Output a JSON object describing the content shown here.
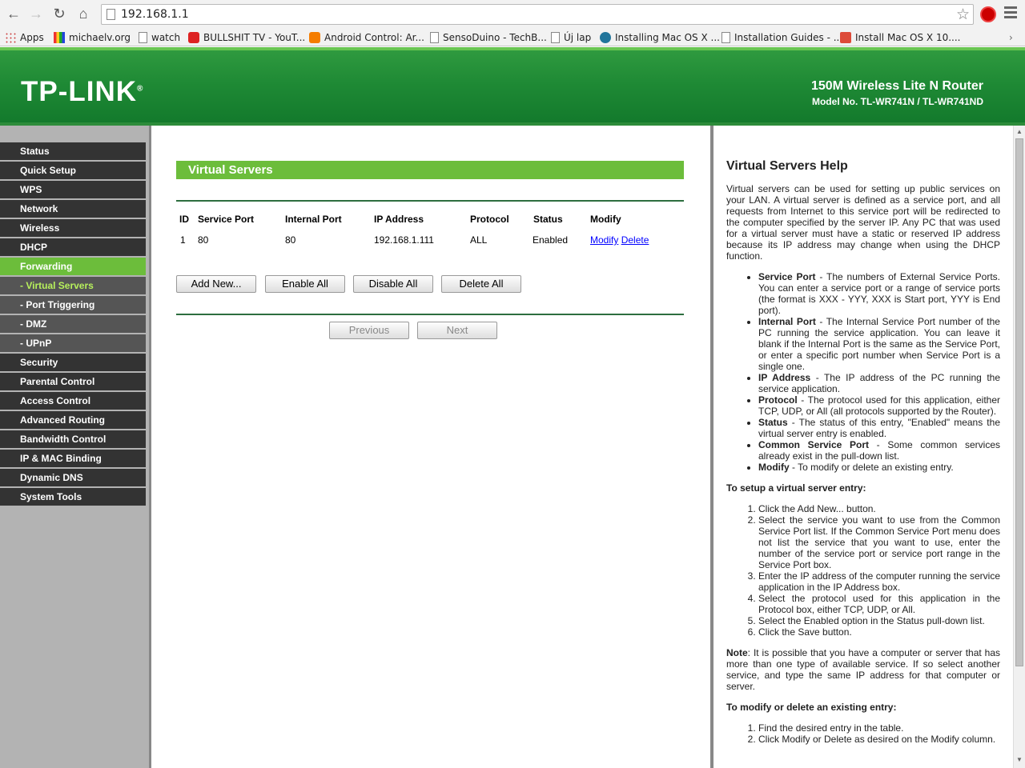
{
  "browser": {
    "url": "192.168.1.1",
    "bookmarks": [
      {
        "label": "Apps",
        "icon": "apps-grid-icon"
      },
      {
        "label": "michaelv.org",
        "icon": "site-icon"
      },
      {
        "label": "watch",
        "icon": "page-icon"
      },
      {
        "label": "BULLSHIT TV - YouT...",
        "icon": "youtube-icon"
      },
      {
        "label": "Android Control: Ar...",
        "icon": "blogger-icon"
      },
      {
        "label": "SensoDuino - TechB...",
        "icon": "page-icon"
      },
      {
        "label": "Új lap",
        "icon": "page-icon"
      },
      {
        "label": "Installing Mac OS X ...",
        "icon": "wordpress-icon"
      },
      {
        "label": "Installation Guides - ...",
        "icon": "page-icon"
      },
      {
        "label": "Install Mac OS X 10....",
        "icon": "google-plus-icon"
      }
    ]
  },
  "banner": {
    "logo": "TP-LINK",
    "logo_mark": "®",
    "product_name": "150M Wireless Lite N Router",
    "model": "Model No. TL-WR741N / TL-WR741ND"
  },
  "sidebar": {
    "items": [
      {
        "label": "Status"
      },
      {
        "label": "Quick Setup"
      },
      {
        "label": "WPS"
      },
      {
        "label": "Network"
      },
      {
        "label": "Wireless"
      },
      {
        "label": "DHCP"
      },
      {
        "label": "Forwarding"
      },
      {
        "label": "- Virtual Servers"
      },
      {
        "label": "- Port Triggering"
      },
      {
        "label": "- DMZ"
      },
      {
        "label": "- UPnP"
      },
      {
        "label": "Security"
      },
      {
        "label": "Parental Control"
      },
      {
        "label": "Access Control"
      },
      {
        "label": "Advanced Routing"
      },
      {
        "label": "Bandwidth Control"
      },
      {
        "label": "IP & MAC Binding"
      },
      {
        "label": "Dynamic DNS"
      },
      {
        "label": "System Tools"
      }
    ]
  },
  "main": {
    "title": "Virtual Servers",
    "columns": [
      "ID",
      "Service Port",
      "Internal Port",
      "IP Address",
      "Protocol",
      "Status",
      "Modify"
    ],
    "rows": [
      {
        "id": "1",
        "service_port": "80",
        "internal_port": "80",
        "ip": "192.168.1.111",
        "protocol": "ALL",
        "status": "Enabled",
        "modify": "Modify",
        "delete": "Delete"
      }
    ],
    "buttons": {
      "add_new": "Add New...",
      "enable_all": "Enable All",
      "disable_all": "Disable All",
      "delete_all": "Delete All",
      "previous": "Previous",
      "next": "Next"
    }
  },
  "help": {
    "title": "Virtual Servers Help",
    "intro": "Virtual servers can be used for setting up public services on your LAN. A virtual server is defined as a service port, and all requests from Internet to this service port will be redirected to the computer specified by the server IP. Any PC that was used for a virtual server must have a static or reserved IP address because its IP address may change when using the DHCP function.",
    "fields": [
      {
        "term": "Service Port",
        "desc": " - The numbers of External Service Ports. You can enter a service port or a range of service ports (the format is XXX - YYY, XXX is Start port, YYY is End port)."
      },
      {
        "term": "Internal Port",
        "desc": " - The Internal Service Port number of the PC running the service application. You can leave it blank if the Internal Port is the same as the Service Port, or enter a specific port number when Service Port is a single one."
      },
      {
        "term": "IP Address",
        "desc": " - The IP address of the PC running the service application."
      },
      {
        "term": "Protocol",
        "desc": " - The protocol used for this application, either TCP, UDP, or All (all protocols supported by the Router)."
      },
      {
        "term": "Status",
        "desc": " - The status of this entry, \"Enabled\" means the virtual server entry is enabled."
      },
      {
        "term": "Common Service Port",
        "desc": " - Some common services already exist in the pull-down list."
      },
      {
        "term": "Modify",
        "desc": " - To modify or delete an existing entry."
      }
    ],
    "setup_heading": "To setup a virtual server entry",
    "setup_steps": [
      "Click the Add New... button.",
      "Select the service you want to use from the Common Service Port list. If the Common Service Port menu does not list the service that you want to use, enter the number of the service port or service port range in the Service Port box.",
      "Enter the IP address of the computer running the service application in the IP Address box.",
      "Select the protocol used for this application in the Protocol box, either TCP, UDP, or All.",
      "Select the Enabled option in the Status pull-down list.",
      "Click the Save button."
    ],
    "note_label": "Note",
    "note": ": It is possible that you have a computer or server that has more than one type of available service. If so select another service, and type the same IP address for that computer or server.",
    "modify_heading": "To modify or delete an existing entry",
    "modify_steps": [
      "Find the desired entry in the table.",
      "Click Modify or Delete as desired on the Modify column."
    ]
  }
}
